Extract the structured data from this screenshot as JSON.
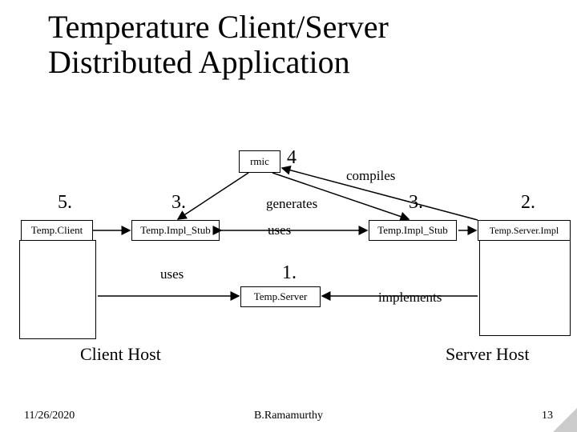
{
  "title": "Temperature Client/Server Distributed Application",
  "boxes": {
    "rmic": "rmic",
    "tempClient": "Temp.Client",
    "stubLeft": "Temp.Impl_Stub",
    "stubRight": "Temp.Impl_Stub",
    "serverImpl": "Temp.Server.Impl",
    "tempServer": "Temp.Server"
  },
  "labels": {
    "compiles": "compiles",
    "generates": "generates",
    "usesTop": "uses",
    "usesMid": "uses",
    "implements": "implements",
    "clientHost": "Client Host",
    "serverHost": "Server Host"
  },
  "numbers": {
    "n1": "1.",
    "n2": "2.",
    "n3a": "3.",
    "n3b": "3.",
    "n4": "4",
    "n5": "5."
  },
  "footer": {
    "date": "11/26/2020",
    "author": "B.Ramamurthy",
    "page": "13"
  }
}
